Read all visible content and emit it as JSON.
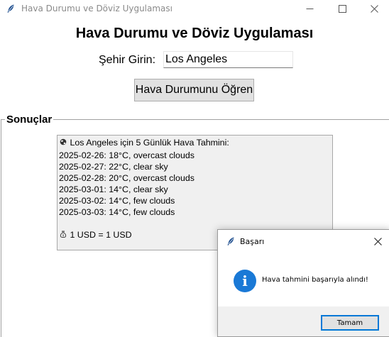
{
  "window": {
    "title": "Hava Durumu ve Döviz Uygulaması",
    "app_icon": "feather-icon",
    "controls": [
      "minimize-icon",
      "maximize-icon",
      "close-icon"
    ]
  },
  "header": {
    "title": "Hava Durumu ve Döviz Uygulaması"
  },
  "form": {
    "city_label": "Şehir Girin:",
    "city_value": "Los Angeles",
    "submit_label": "Hava Durumunu Öğren"
  },
  "results": {
    "group_label": "Sonuçlar",
    "forecast_header": "Los Angeles için 5 Günlük Hava Tahmini:",
    "forecast_icon": "globe-icon",
    "forecast": [
      "2025-02-26: 18°C, overcast clouds",
      "2025-02-27: 22°C, clear sky",
      "2025-02-28: 20°C, overcast clouds",
      "2025-03-01: 14°C, clear sky",
      "2025-03-02: 14°C, few clouds",
      "2025-03-03: 14°C, few clouds"
    ],
    "currency_icon": "money-bag-icon",
    "currency_line": "1 USD = 1 USD"
  },
  "dialog": {
    "title": "Başarı",
    "icon": "info-icon",
    "message": "Hava tahmini başarıyla alındı!",
    "ok_label": "Tamam"
  },
  "colors": {
    "accent": "#0078d7",
    "info_icon": "#1a79d6",
    "results_bg": "#f0f0f0",
    "button_bg": "#e1e1e1"
  }
}
